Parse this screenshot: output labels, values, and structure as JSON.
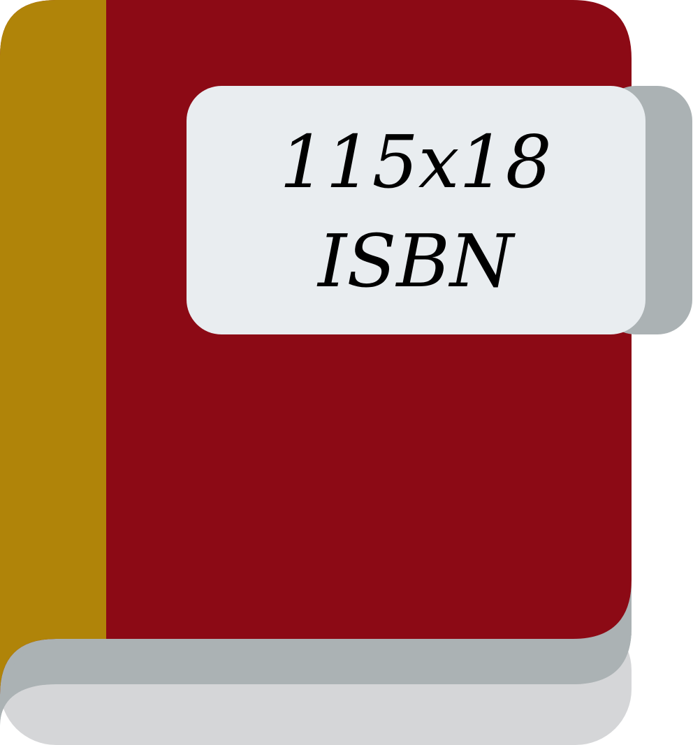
{
  "icon": {
    "name": "book-icon",
    "colors": {
      "cover": "#8c0a15",
      "spine": "#b08409",
      "pages_shadow": "#abb2b4",
      "pages_bottom": "#d5d6d8",
      "label_background": "#e9edf0",
      "label_tab": "#abb2b4",
      "text": "#000000"
    }
  },
  "label": {
    "line1": "115x18",
    "line2": "ISBN"
  }
}
